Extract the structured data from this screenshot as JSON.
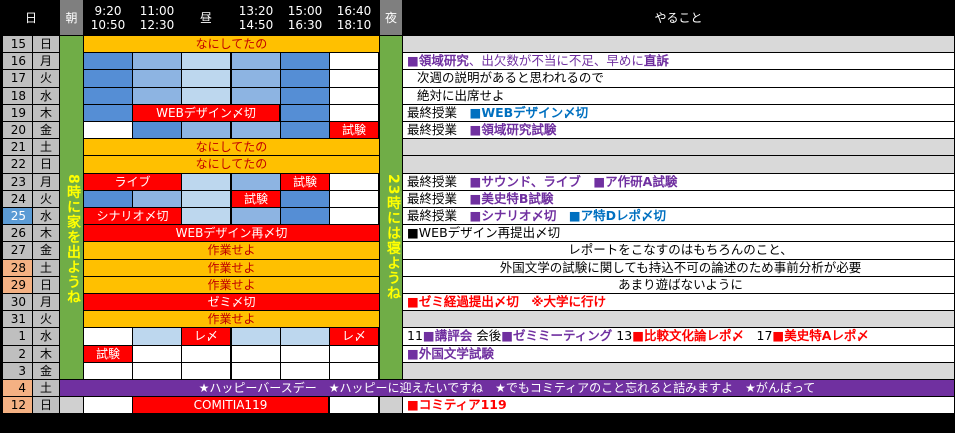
{
  "headers": {
    "day": "日",
    "morning": "朝",
    "slots": [
      {
        "start": "9:20",
        "end": "10:50"
      },
      {
        "start": "11:00",
        "end": "12:30"
      },
      {
        "start": "昼",
        "end": ""
      },
      {
        "start": "13:20",
        "end": "14:50"
      },
      {
        "start": "15:00",
        "end": "16:30"
      },
      {
        "start": "16:40",
        "end": "18:10"
      }
    ],
    "night": "夜",
    "todo": "やること"
  },
  "morning_note": "8時に家を出ようね",
  "night_note": "23時には寝ようね",
  "colors": {
    "header_bg": "#000000",
    "gray_col": "#7f7f7f",
    "green_bar": "#70ad47",
    "orange": "#ffc000",
    "red": "#ff0000",
    "blue": "#558ed5",
    "light_blue": "#8db4e2",
    "today": "#5b9bd5",
    "weekend_pink": "#f4b183",
    "purple": "#7030a0"
  },
  "rows": [
    {
      "date": "15",
      "dow": "日",
      "type": "weekend",
      "span_text": "なにしてたの",
      "span_color": "orange",
      "note": [
        {
          "t": "",
          "c": "plain"
        }
      ]
    },
    {
      "date": "16",
      "dow": "月",
      "cells": [
        "blue",
        "lblue",
        "pale",
        "lblue",
        "blue",
        "white"
      ],
      "labels": [
        "",
        "",
        "",
        "",
        "",
        ""
      ],
      "note": [
        {
          "t": "■",
          "c": "pr"
        },
        {
          "t": "領域研究",
          "c": "pr"
        },
        {
          "t": "、出欠数が不当に不足、早めに",
          "c": "prn"
        },
        {
          "t": "直訴",
          "c": "pr"
        }
      ]
    },
    {
      "date": "17",
      "dow": "火",
      "cells": [
        "blue",
        "lblue",
        "pale",
        "lblue",
        "blue",
        "white"
      ],
      "labels": [
        "",
        "",
        "",
        "",
        "",
        ""
      ],
      "note": [
        {
          "t": "次週の説明があると思われるので",
          "c": "plain",
          "indent": true
        }
      ]
    },
    {
      "date": "18",
      "dow": "水",
      "cells": [
        "blue",
        "lblue",
        "pale",
        "lblue",
        "blue",
        "white"
      ],
      "labels": [
        "",
        "",
        "",
        "",
        "",
        ""
      ],
      "note": [
        {
          "t": "絶対に出席せよ",
          "c": "plain",
          "indent": true
        }
      ]
    },
    {
      "date": "19",
      "dow": "木",
      "cells": [
        "blue",
        "span-red",
        "span-red",
        "span-red",
        "blue",
        "white"
      ],
      "span_label": "WEBデザイン〆切",
      "note": [
        {
          "t": "最終授業　",
          "c": "plain"
        },
        {
          "t": "■",
          "c": "bl"
        },
        {
          "t": "WEBデザイン〆切",
          "c": "bl"
        }
      ]
    },
    {
      "date": "20",
      "dow": "金",
      "cells": [
        "white",
        "blue",
        "lblue",
        "lblue",
        "blue",
        "red"
      ],
      "labels": [
        "",
        "",
        "",
        "",
        "",
        "試験"
      ],
      "note": [
        {
          "t": "最終授業　",
          "c": "plain"
        },
        {
          "t": "■",
          "c": "pr"
        },
        {
          "t": "領域研究試験",
          "c": "pr"
        }
      ]
    },
    {
      "date": "21",
      "dow": "土",
      "type": "weekend",
      "span_text": "なにしてたの",
      "span_color": "orange",
      "note": [
        {
          "t": "",
          "c": "plain"
        }
      ]
    },
    {
      "date": "22",
      "dow": "日",
      "type": "weekend",
      "span_text": "なにしてたの",
      "span_color": "orange",
      "note": [
        {
          "t": "",
          "c": "plain"
        }
      ]
    },
    {
      "date": "23",
      "dow": "月",
      "cells": [
        "span-red2",
        "span-red2",
        "pale",
        "lblue",
        "red",
        "white"
      ],
      "span_label": "ライブ",
      "labels": [
        "",
        "",
        "",
        "",
        "試験",
        ""
      ],
      "note": [
        {
          "t": "最終授業　",
          "c": "plain"
        },
        {
          "t": "■",
          "c": "pr"
        },
        {
          "t": "サウンド、ライブ　",
          "c": "pr"
        },
        {
          "t": "■",
          "c": "pr"
        },
        {
          "t": "ア作研A試験",
          "c": "pr"
        }
      ]
    },
    {
      "date": "24",
      "dow": "火",
      "cells": [
        "blue",
        "lblue",
        "pale",
        "red",
        "blue",
        "white"
      ],
      "labels": [
        "",
        "",
        "",
        "試験",
        "",
        ""
      ],
      "note": [
        {
          "t": "最終授業　",
          "c": "plain"
        },
        {
          "t": "■",
          "c": "pr"
        },
        {
          "t": "美史特B試験",
          "c": "pr"
        }
      ]
    },
    {
      "date": "25",
      "dow": "水",
      "today": true,
      "cells": [
        "span-red2",
        "span-red2",
        "pale",
        "lblue",
        "blue",
        "white"
      ],
      "span_label": "シナリオ〆切",
      "note": [
        {
          "t": "最終授業　",
          "c": "plain"
        },
        {
          "t": "■",
          "c": "pr"
        },
        {
          "t": "シナリオ〆切　",
          "c": "pr"
        },
        {
          "t": "■",
          "c": "bl"
        },
        {
          "t": "ア特Dレポ〆切",
          "c": "bl"
        }
      ]
    },
    {
      "date": "26",
      "dow": "木",
      "type": "fullspan",
      "span_text": "WEBデザイン再〆切",
      "span_color": "red",
      "note": [
        {
          "t": "■WEBデザイン再提出〆切",
          "c": "plain"
        }
      ]
    },
    {
      "date": "27",
      "dow": "金",
      "type": "fullspan",
      "span_text": "作業せよ",
      "span_color": "orange",
      "note": [
        {
          "t": "レポートをこなすのはもちろんのこと、",
          "c": "center"
        }
      ]
    },
    {
      "date": "28",
      "dow": "土",
      "weekend": true,
      "type": "fullspan",
      "span_text": "作業せよ",
      "span_color": "orange",
      "note": [
        {
          "t": "外国文学の試験に関しても持込不可の論述のため事前分析が必要",
          "c": "center"
        }
      ]
    },
    {
      "date": "29",
      "dow": "日",
      "weekend": true,
      "type": "fullspan",
      "span_text": "作業せよ",
      "span_color": "orange",
      "note": [
        {
          "t": "あまり遊ばないように",
          "c": "center"
        }
      ]
    },
    {
      "date": "30",
      "dow": "月",
      "type": "fullspan",
      "span_text": "ゼミ〆切",
      "span_color": "red",
      "note": [
        {
          "t": "■",
          "c": "rd"
        },
        {
          "t": "ゼミ経過提出〆切　※大学に行け",
          "c": "rd"
        }
      ]
    },
    {
      "date": "31",
      "dow": "火",
      "type": "fullspan",
      "span_text": "作業せよ",
      "span_color": "orange",
      "note": [
        {
          "t": "",
          "c": "plain"
        }
      ]
    },
    {
      "date": "1",
      "dow": "水",
      "cells": [
        "white",
        "pale",
        "red",
        "pale",
        "pale",
        "red"
      ],
      "labels": [
        "",
        "",
        "レ〆",
        "",
        "",
        "レ〆"
      ],
      "note": [
        {
          "t": "11",
          "c": "plain"
        },
        {
          "t": "■",
          "c": "pr"
        },
        {
          "t": "講評会",
          "c": "pr"
        },
        {
          "t": " 会後",
          "c": "plain"
        },
        {
          "t": "■",
          "c": "pr"
        },
        {
          "t": "ゼミミーティング",
          "c": "pr"
        },
        {
          "t": " 13",
          "c": "plain"
        },
        {
          "t": "■",
          "c": "rd"
        },
        {
          "t": "比較文化論レポ〆",
          "c": "rd"
        },
        {
          "t": "　17",
          "c": "plain"
        },
        {
          "t": "■",
          "c": "rd"
        },
        {
          "t": "美史特Aレポ〆",
          "c": "rd"
        }
      ]
    },
    {
      "date": "2",
      "dow": "木",
      "cells": [
        "red",
        "white",
        "white",
        "white",
        "white",
        "white"
      ],
      "labels": [
        "試験",
        "",
        "",
        "",
        "",
        ""
      ],
      "note": [
        {
          "t": "■",
          "c": "pr"
        },
        {
          "t": "外国文学試験",
          "c": "pr"
        }
      ]
    },
    {
      "date": "3",
      "dow": "金",
      "cells": [
        "white",
        "white",
        "white",
        "white",
        "white",
        "white"
      ],
      "labels": [
        "",
        "",
        "",
        "",
        "",
        ""
      ],
      "note": [
        {
          "t": "",
          "c": "plain"
        }
      ]
    },
    {
      "date": "4",
      "dow": "土",
      "weekend": true,
      "type": "banner",
      "span_text": "★ハッピーバースデー　★ハッピーに迎えたいですね　★でもコミティアのこと忘れると詰みますよ　★がんばって"
    },
    {
      "date": "12",
      "dow": "日",
      "weekend": true,
      "type": "comitia",
      "span_text": "COMITIA119",
      "note": [
        {
          "t": "■",
          "c": "rd"
        },
        {
          "t": "コミティア119",
          "c": "rd"
        }
      ]
    }
  ]
}
